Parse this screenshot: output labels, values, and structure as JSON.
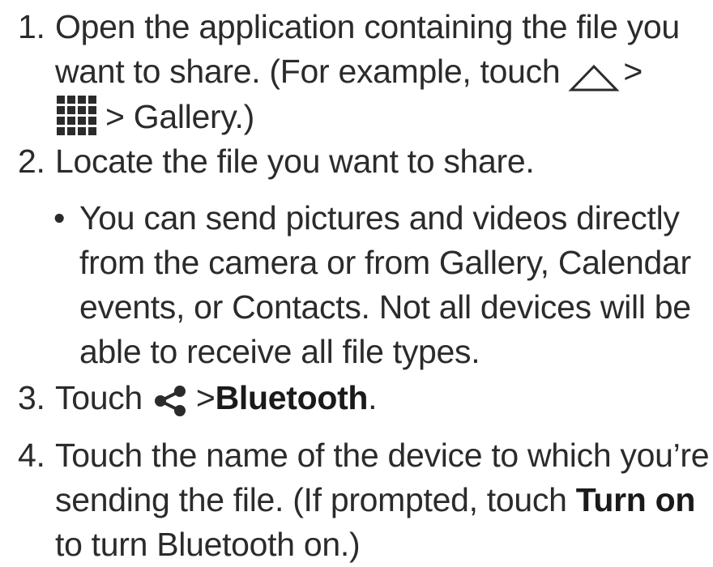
{
  "steps": [
    {
      "number": "1.",
      "line1": "Open the application containing the file you",
      "line2_prefix": "want to share. (For example, touch",
      "line2_suffix": ">",
      "line3_prefix": "> ",
      "line3_suffix": "Gallery.)"
    },
    {
      "number": "2.",
      "line1": "Locate the file you want to share."
    },
    {
      "number": "3.",
      "prefix": "Touch",
      "sep": ">",
      "bold": "Bluetooth",
      "suffix": "."
    },
    {
      "number": "4.",
      "line1": "Touch the name of the device to which you’re",
      "line2_prefix": "sending the file. (If prompted, touch ",
      "line2_bold": "Turn on",
      "line3": "to turn Bluetooth on.)"
    }
  ],
  "bullet": {
    "dot": "•",
    "lines": [
      "You can send pictures and videos directly",
      "from the camera or from Gallery, Calendar",
      "events, or Contacts. Not all devices will be",
      "able to receive all file types."
    ]
  },
  "icons": {
    "home": "home-outline-icon",
    "apps": "apps-grid-icon",
    "share": "share-icon"
  }
}
